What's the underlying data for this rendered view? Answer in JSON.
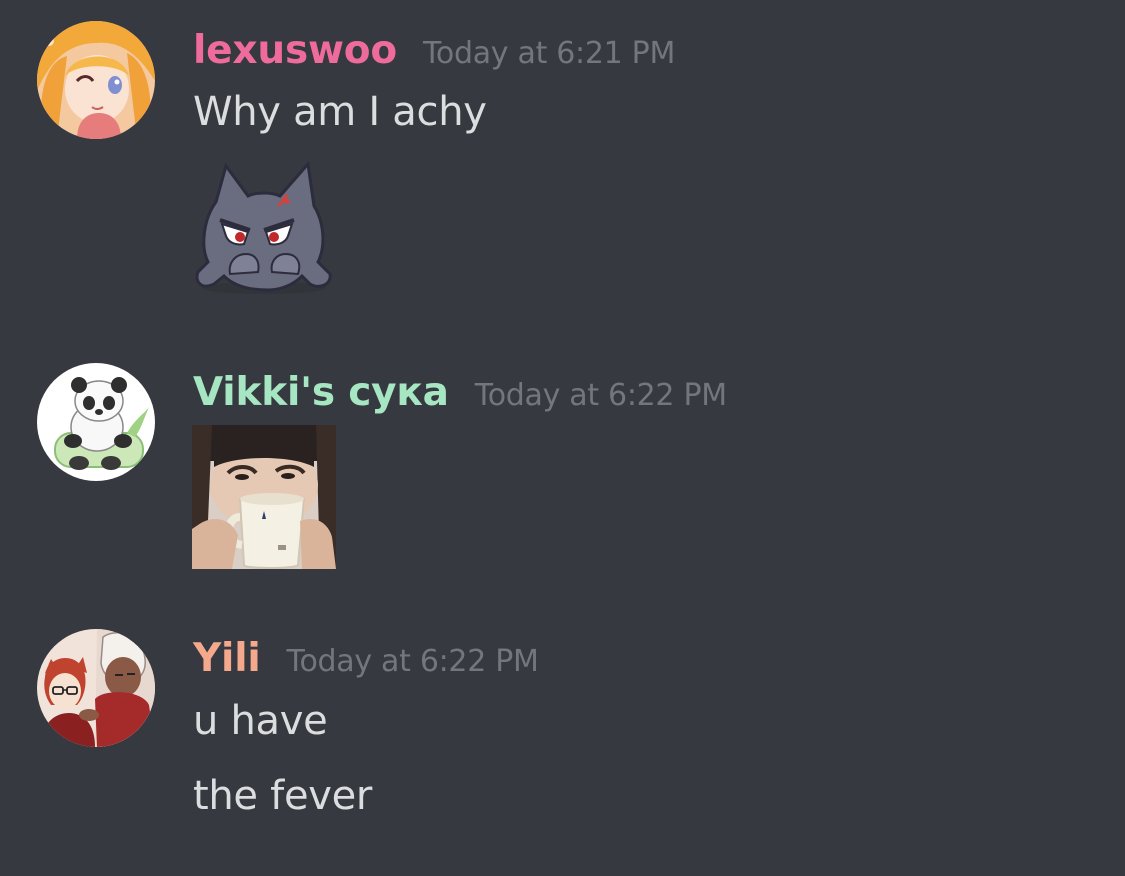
{
  "messages": [
    {
      "username": "lexuswoo",
      "username_color": "#ee6b9c",
      "timestamp": "Today at 6:21 PM",
      "lines": [
        "Why am I achy"
      ],
      "attachment": "angry-ghost-sticker"
    },
    {
      "username": "Vikki's сука",
      "username_color": "#a6e6c2",
      "timestamp": "Today at 6:22 PM",
      "lines": [],
      "attachment": "woman-drinking-from-mug-photo"
    },
    {
      "username": "Yili",
      "username_color": "#f4a98c",
      "timestamp": "Today at 6:22 PM",
      "lines": [
        "u have",
        "the fever"
      ],
      "attachment": null
    }
  ],
  "colors": {
    "background": "#36393f",
    "timestamp": "#72767d",
    "message_text": "#dcddde"
  }
}
